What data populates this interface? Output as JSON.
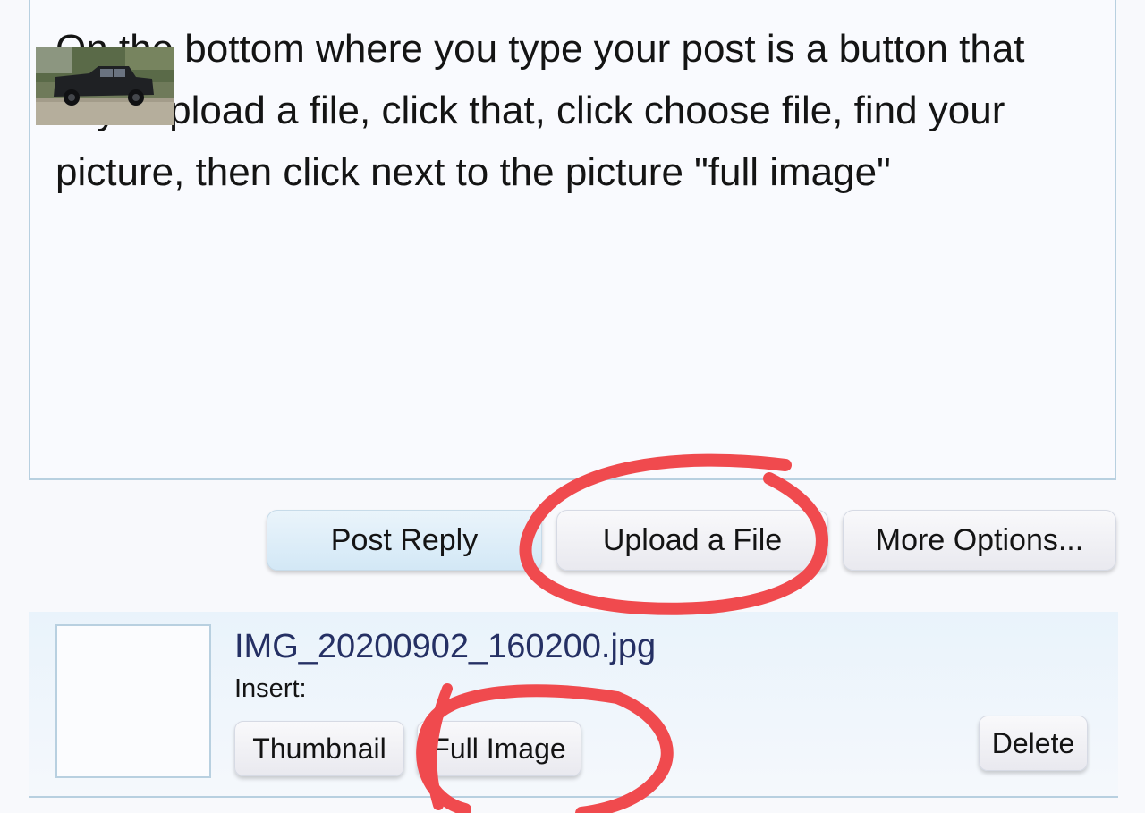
{
  "editor": {
    "text": "On the bottom where you type your post is a button that says upload a file, click that, click choose file, find your picture, then click next to the picture \"full image\""
  },
  "buttons": {
    "post_reply": "Post Reply",
    "upload_file": "Upload a File",
    "more_options": "More Options..."
  },
  "attachment": {
    "filename": "IMG_20200902_160200.jpg",
    "insert_label": "Insert:",
    "thumbnail_button": "Thumbnail",
    "full_image_button": "Full Image",
    "delete_button": "Delete"
  },
  "colors": {
    "annotation": "#f04a4e",
    "border": "#b8d0e0",
    "filename": "#253064"
  }
}
